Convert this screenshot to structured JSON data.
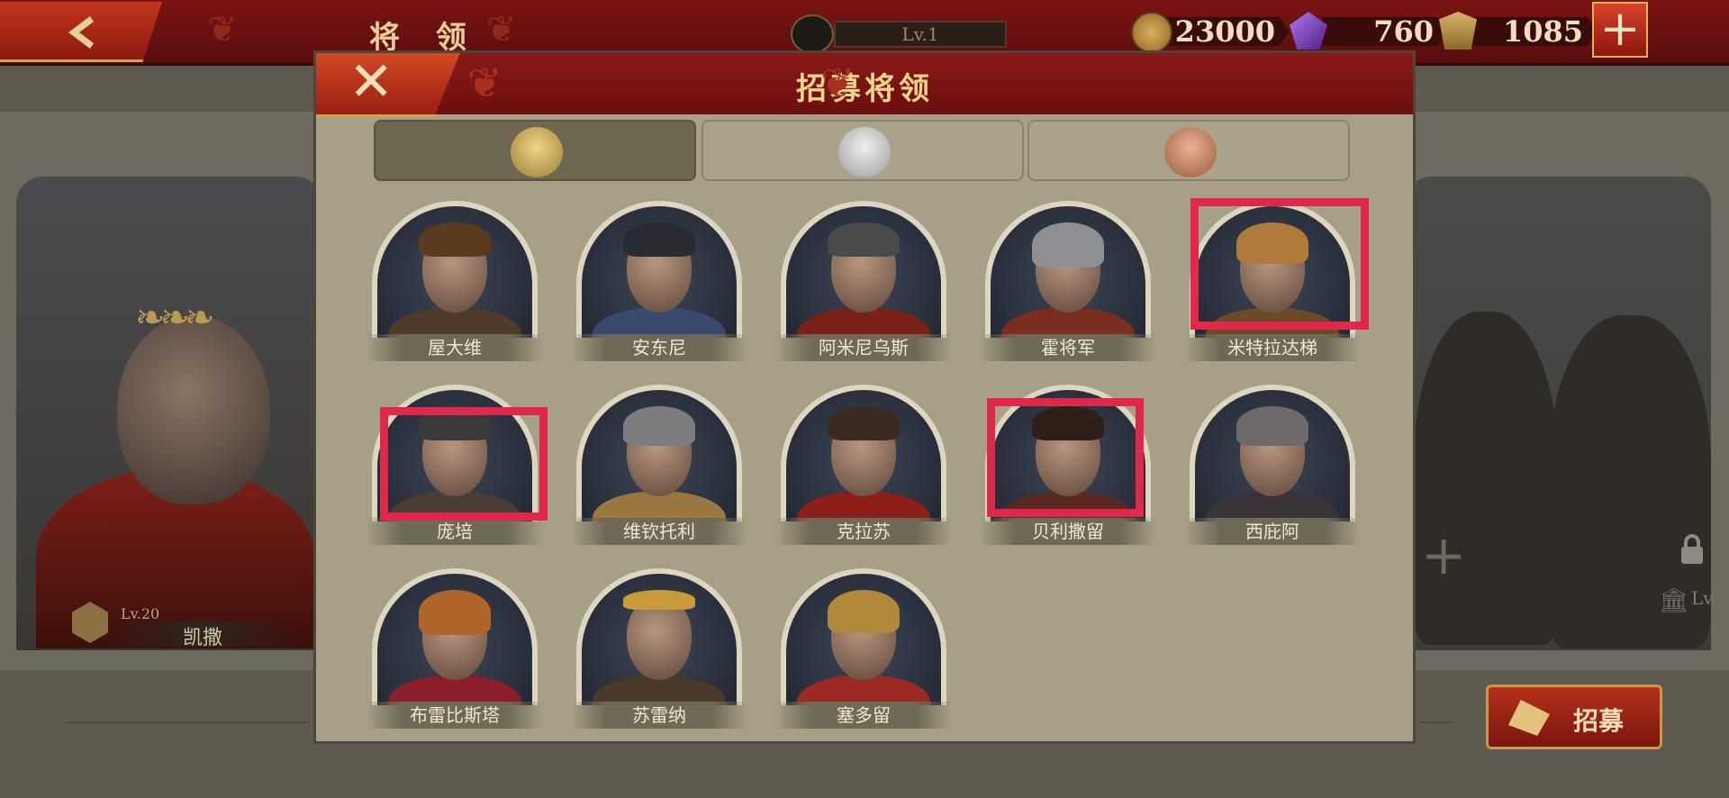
{
  "topbar": {
    "title": "将 领",
    "level": "Lv.1",
    "coins": "23000",
    "gems": "760",
    "honor": "1085",
    "plus": "+"
  },
  "background": {
    "hero_level": "Lv.20",
    "hero_name": "凯撒",
    "plus_slot": "+",
    "locked_level": "Lv",
    "recruit_label": "招募"
  },
  "modal": {
    "title": "招募将领",
    "close": "✕",
    "tabs": [
      {
        "tier": "gold",
        "active": true
      },
      {
        "tier": "silver",
        "active": false
      },
      {
        "tier": "bronze",
        "active": false
      }
    ],
    "heroes": [
      {
        "name": "屋大维",
        "highlighted": false
      },
      {
        "name": "安东尼",
        "highlighted": false
      },
      {
        "name": "阿米尼乌斯",
        "highlighted": false
      },
      {
        "name": "霍将军",
        "highlighted": false
      },
      {
        "name": "米特拉达梯",
        "highlighted": true
      },
      {
        "name": "庞培",
        "highlighted": true
      },
      {
        "name": "维钦托利",
        "highlighted": false
      },
      {
        "name": "克拉苏",
        "highlighted": false
      },
      {
        "name": "贝利撒留",
        "highlighted": true
      },
      {
        "name": "西庇阿",
        "highlighted": false
      },
      {
        "name": "布雷比斯塔",
        "highlighted": false
      },
      {
        "name": "苏雷纳",
        "highlighted": false
      },
      {
        "name": "塞多留",
        "highlighted": false
      }
    ]
  },
  "colors": {
    "header_red": "#7a1414",
    "highlight": "#e0294a",
    "gold_text": "#f0d48c"
  }
}
